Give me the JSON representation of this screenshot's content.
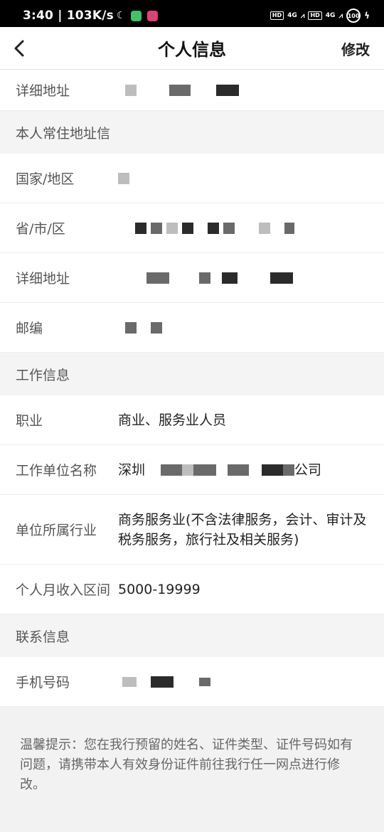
{
  "status_bar": {
    "time": "3:40 | 103K/s",
    "hd": "HD",
    "net": "4G",
    "battery": "100"
  },
  "nav": {
    "title": "个人信息",
    "edit_label": "修改"
  },
  "rows": {
    "addr_detail_top": {
      "label": "详细地址"
    },
    "residence_header": {
      "label": "本人常住地址信"
    },
    "country": {
      "label": "国家/地区"
    },
    "province": {
      "label": "省/市/区"
    },
    "addr_detail": {
      "label": "详细地址"
    },
    "postcode": {
      "label": "邮编"
    },
    "work_header": {
      "label": "工作信息"
    },
    "occupation": {
      "label": "职业",
      "value": "商业、服务业人员"
    },
    "employer": {
      "label": "工作单位名称",
      "value_prefix": "深圳",
      "value_suffix": "公司"
    },
    "industry": {
      "label": "单位所属行业",
      "value": "商务服务业(不含法律服务，会计、审计及税务服务，旅行社及相关服务)"
    },
    "income": {
      "label": "个人月收入区间",
      "value": "5000-19999"
    },
    "contact_header": {
      "label": "联系信息"
    },
    "phone": {
      "label": "手机号码"
    }
  },
  "tip": "温馨提示：您在我行预留的姓名、证件类型、证件号码如有问题，请携带本人有效身份证件前往我行任一网点进行修改。"
}
